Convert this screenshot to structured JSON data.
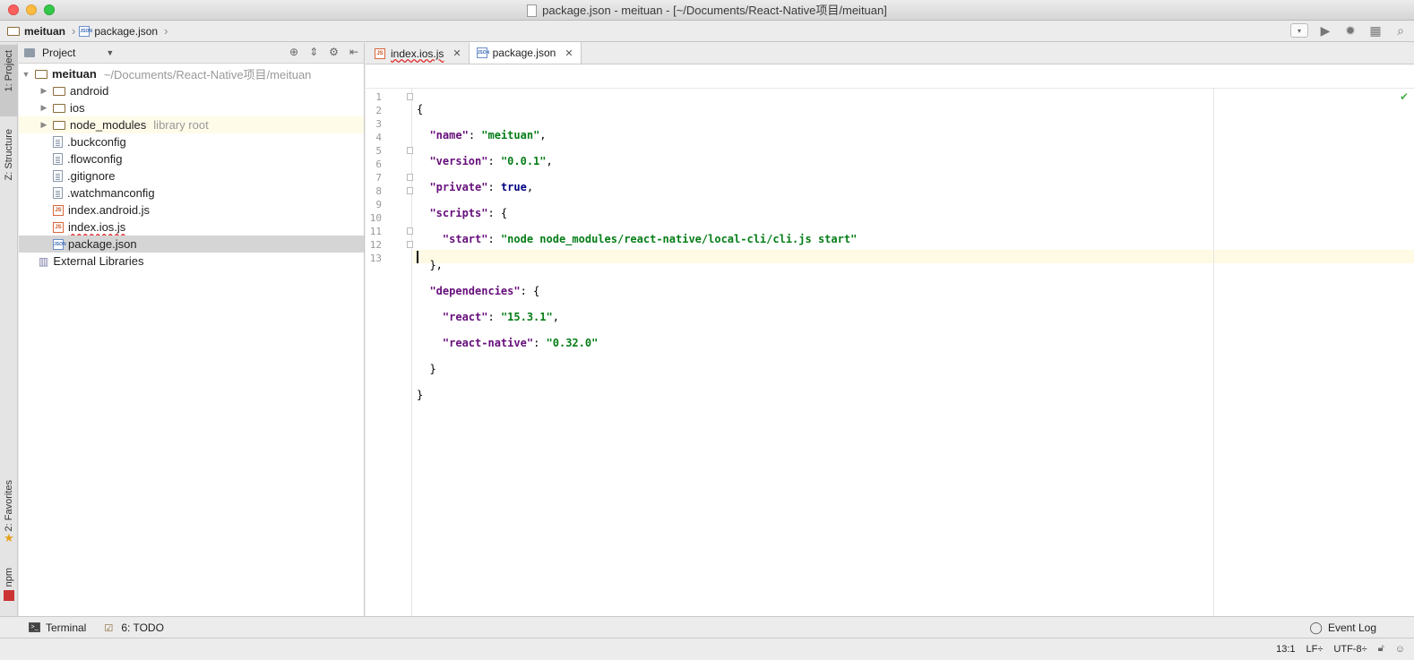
{
  "window": {
    "title": "package.json - meituan - [~/Documents/React-Native项目/meituan]"
  },
  "navbar": {
    "breadcrumbs": [
      "meituan",
      "package.json"
    ]
  },
  "left_toolbar": {
    "project_tab": "1: Project",
    "structure_tab": "Z: Structure",
    "favorites_tab": "2: Favorites",
    "npm_tab": "npm"
  },
  "project_panel": {
    "header": "Project",
    "root": {
      "name": "meituan",
      "path": "~/Documents/React-Native项目/meituan"
    },
    "items": [
      {
        "label": "android",
        "type": "folder"
      },
      {
        "label": "ios",
        "type": "folder"
      },
      {
        "label": "node_modules",
        "type": "folder",
        "note": "library root"
      },
      {
        "label": ".buckconfig",
        "type": "file"
      },
      {
        "label": ".flowconfig",
        "type": "file"
      },
      {
        "label": ".gitignore",
        "type": "file"
      },
      {
        "label": ".watchmanconfig",
        "type": "file"
      },
      {
        "label": "index.android.js",
        "type": "js"
      },
      {
        "label": "index.ios.js",
        "type": "js"
      },
      {
        "label": "package.json",
        "type": "json"
      }
    ],
    "external": "External Libraries"
  },
  "editor": {
    "tabs": [
      {
        "label": "index.ios.js",
        "active": false
      },
      {
        "label": "package.json",
        "active": true
      }
    ],
    "line_numbers": [
      "1",
      "2",
      "3",
      "4",
      "5",
      "6",
      "7",
      "8",
      "9",
      "10",
      "11",
      "12",
      "13"
    ]
  },
  "bottom_bar": {
    "terminal": "Terminal",
    "todo": "6: TODO",
    "event_log": "Event Log"
  },
  "status_bar": {
    "position": "13:1",
    "line_sep": "LF÷",
    "encoding": "UTF-8÷"
  },
  "colors": {
    "key": "#660e7a",
    "string": "#067d17",
    "keyword": "#000080",
    "current_line": "#fffae3",
    "selected_row": "#d5d5d5"
  }
}
